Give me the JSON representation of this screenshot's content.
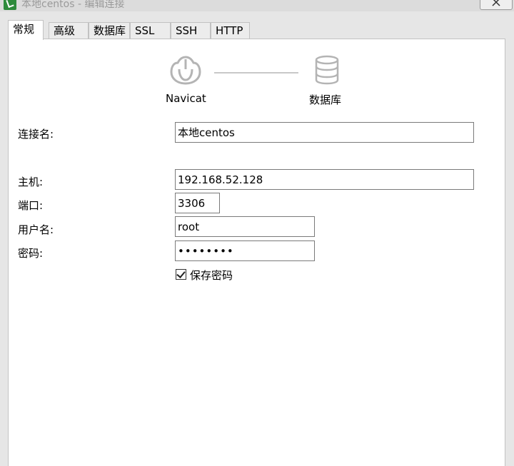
{
  "window": {
    "title": "本地centos - 编辑连接"
  },
  "tabs": [
    {
      "label": "常规",
      "active": true
    },
    {
      "label": "高级"
    },
    {
      "label": "数据库"
    },
    {
      "label": "SSL"
    },
    {
      "label": "SSH"
    },
    {
      "label": "HTTP"
    }
  ],
  "connection_diagram": {
    "source_label": "Navicat",
    "target_label": "数据库"
  },
  "form": {
    "connection_name": {
      "label": "连接名:",
      "value": "本地centos"
    },
    "host": {
      "label": "主机:",
      "value": "192.168.52.128"
    },
    "port": {
      "label": "端口:",
      "value": "3306"
    },
    "username": {
      "label": "用户名:",
      "value": "root"
    },
    "password": {
      "label": "密码:",
      "value": "••••••••"
    },
    "save_password": {
      "label": "保存密码",
      "checked": true
    }
  },
  "icons": {
    "app": "navicat-app-icon",
    "close": "close-icon",
    "navicat": "navicat-logo-icon",
    "database": "database-icon"
  }
}
